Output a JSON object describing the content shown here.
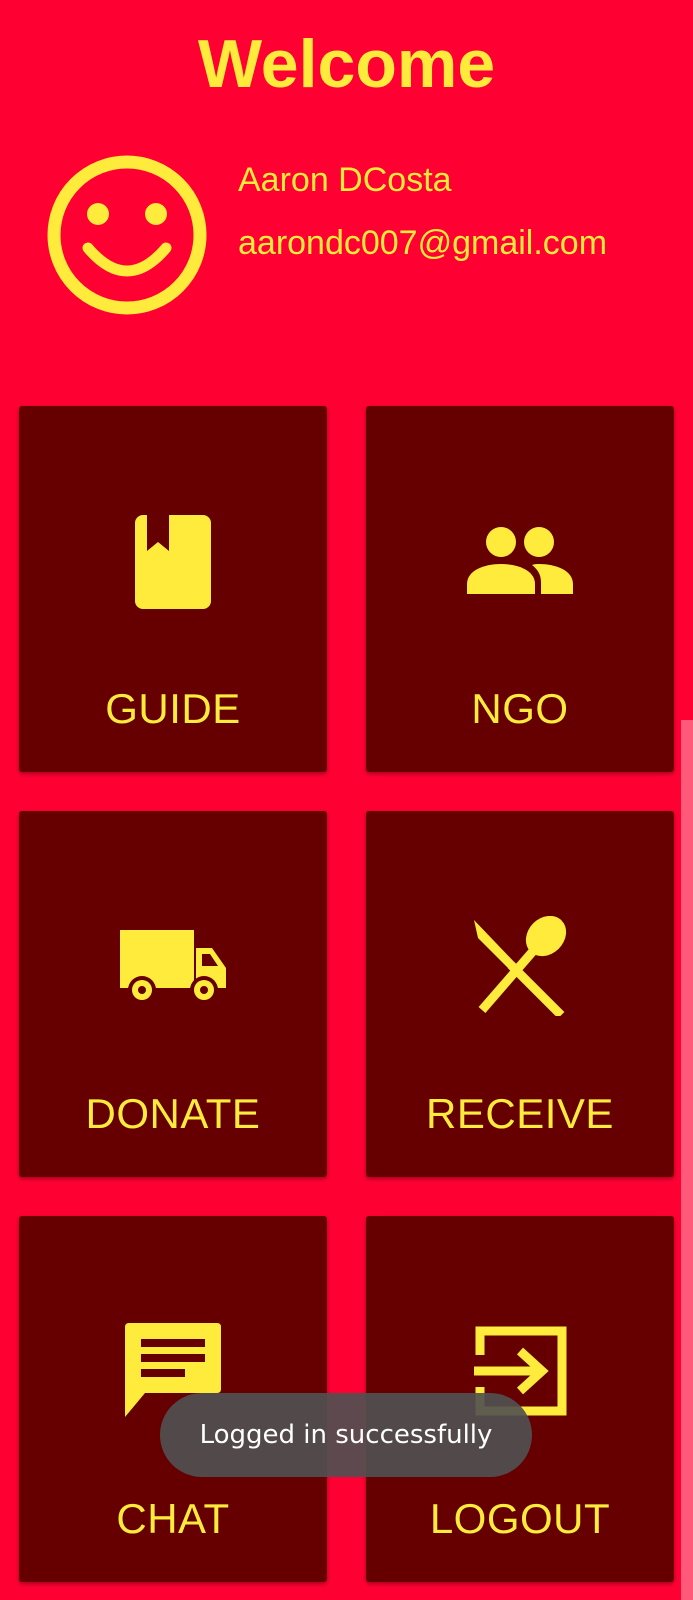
{
  "header": {
    "title": "Welcome"
  },
  "profile": {
    "avatar_icon": "smiley-face-icon",
    "name": "Aaron DCosta",
    "email": "aarondc007@gmail.com"
  },
  "menu": [
    {
      "label": "GUIDE",
      "icon": "book-bookmark-icon"
    },
    {
      "label": "NGO",
      "icon": "people-group-icon"
    },
    {
      "label": "DONATE",
      "icon": "delivery-truck-icon"
    },
    {
      "label": "RECEIVE",
      "icon": "knife-spoon-icon"
    },
    {
      "label": "CHAT",
      "icon": "chat-bubble-icon"
    },
    {
      "label": "LOGOUT",
      "icon": "sign-in-arrow-icon"
    }
  ],
  "toast": {
    "message": "Logged in successfully"
  },
  "colors": {
    "background": "#FF0033",
    "card": "#660000",
    "accent": "#FFEB3B",
    "toast": "#505050"
  }
}
